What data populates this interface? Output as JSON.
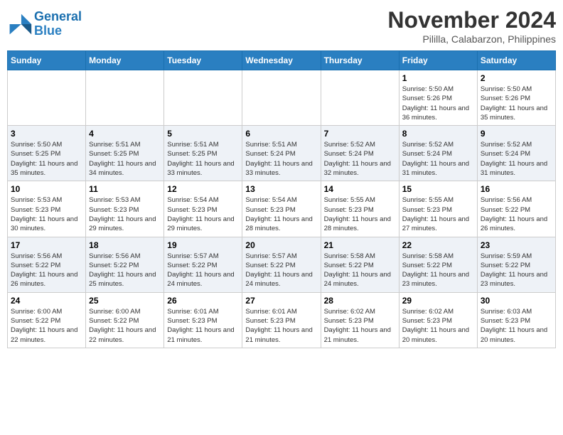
{
  "logo": {
    "line1": "General",
    "line2": "Blue"
  },
  "title": "November 2024",
  "location": "Pililla, Calabarzon, Philippines",
  "days_of_week": [
    "Sunday",
    "Monday",
    "Tuesday",
    "Wednesday",
    "Thursday",
    "Friday",
    "Saturday"
  ],
  "weeks": [
    [
      {
        "day": "",
        "info": ""
      },
      {
        "day": "",
        "info": ""
      },
      {
        "day": "",
        "info": ""
      },
      {
        "day": "",
        "info": ""
      },
      {
        "day": "",
        "info": ""
      },
      {
        "day": "1",
        "info": "Sunrise: 5:50 AM\nSunset: 5:26 PM\nDaylight: 11 hours and 36 minutes."
      },
      {
        "day": "2",
        "info": "Sunrise: 5:50 AM\nSunset: 5:26 PM\nDaylight: 11 hours and 35 minutes."
      }
    ],
    [
      {
        "day": "3",
        "info": "Sunrise: 5:50 AM\nSunset: 5:25 PM\nDaylight: 11 hours and 35 minutes."
      },
      {
        "day": "4",
        "info": "Sunrise: 5:51 AM\nSunset: 5:25 PM\nDaylight: 11 hours and 34 minutes."
      },
      {
        "day": "5",
        "info": "Sunrise: 5:51 AM\nSunset: 5:25 PM\nDaylight: 11 hours and 33 minutes."
      },
      {
        "day": "6",
        "info": "Sunrise: 5:51 AM\nSunset: 5:24 PM\nDaylight: 11 hours and 33 minutes."
      },
      {
        "day": "7",
        "info": "Sunrise: 5:52 AM\nSunset: 5:24 PM\nDaylight: 11 hours and 32 minutes."
      },
      {
        "day": "8",
        "info": "Sunrise: 5:52 AM\nSunset: 5:24 PM\nDaylight: 11 hours and 31 minutes."
      },
      {
        "day": "9",
        "info": "Sunrise: 5:52 AM\nSunset: 5:24 PM\nDaylight: 11 hours and 31 minutes."
      }
    ],
    [
      {
        "day": "10",
        "info": "Sunrise: 5:53 AM\nSunset: 5:23 PM\nDaylight: 11 hours and 30 minutes."
      },
      {
        "day": "11",
        "info": "Sunrise: 5:53 AM\nSunset: 5:23 PM\nDaylight: 11 hours and 29 minutes."
      },
      {
        "day": "12",
        "info": "Sunrise: 5:54 AM\nSunset: 5:23 PM\nDaylight: 11 hours and 29 minutes."
      },
      {
        "day": "13",
        "info": "Sunrise: 5:54 AM\nSunset: 5:23 PM\nDaylight: 11 hours and 28 minutes."
      },
      {
        "day": "14",
        "info": "Sunrise: 5:55 AM\nSunset: 5:23 PM\nDaylight: 11 hours and 28 minutes."
      },
      {
        "day": "15",
        "info": "Sunrise: 5:55 AM\nSunset: 5:23 PM\nDaylight: 11 hours and 27 minutes."
      },
      {
        "day": "16",
        "info": "Sunrise: 5:56 AM\nSunset: 5:22 PM\nDaylight: 11 hours and 26 minutes."
      }
    ],
    [
      {
        "day": "17",
        "info": "Sunrise: 5:56 AM\nSunset: 5:22 PM\nDaylight: 11 hours and 26 minutes."
      },
      {
        "day": "18",
        "info": "Sunrise: 5:56 AM\nSunset: 5:22 PM\nDaylight: 11 hours and 25 minutes."
      },
      {
        "day": "19",
        "info": "Sunrise: 5:57 AM\nSunset: 5:22 PM\nDaylight: 11 hours and 24 minutes."
      },
      {
        "day": "20",
        "info": "Sunrise: 5:57 AM\nSunset: 5:22 PM\nDaylight: 11 hours and 24 minutes."
      },
      {
        "day": "21",
        "info": "Sunrise: 5:58 AM\nSunset: 5:22 PM\nDaylight: 11 hours and 24 minutes."
      },
      {
        "day": "22",
        "info": "Sunrise: 5:58 AM\nSunset: 5:22 PM\nDaylight: 11 hours and 23 minutes."
      },
      {
        "day": "23",
        "info": "Sunrise: 5:59 AM\nSunset: 5:22 PM\nDaylight: 11 hours and 23 minutes."
      }
    ],
    [
      {
        "day": "24",
        "info": "Sunrise: 6:00 AM\nSunset: 5:22 PM\nDaylight: 11 hours and 22 minutes."
      },
      {
        "day": "25",
        "info": "Sunrise: 6:00 AM\nSunset: 5:22 PM\nDaylight: 11 hours and 22 minutes."
      },
      {
        "day": "26",
        "info": "Sunrise: 6:01 AM\nSunset: 5:23 PM\nDaylight: 11 hours and 21 minutes."
      },
      {
        "day": "27",
        "info": "Sunrise: 6:01 AM\nSunset: 5:23 PM\nDaylight: 11 hours and 21 minutes."
      },
      {
        "day": "28",
        "info": "Sunrise: 6:02 AM\nSunset: 5:23 PM\nDaylight: 11 hours and 21 minutes."
      },
      {
        "day": "29",
        "info": "Sunrise: 6:02 AM\nSunset: 5:23 PM\nDaylight: 11 hours and 20 minutes."
      },
      {
        "day": "30",
        "info": "Sunrise: 6:03 AM\nSunset: 5:23 PM\nDaylight: 11 hours and 20 minutes."
      }
    ]
  ]
}
